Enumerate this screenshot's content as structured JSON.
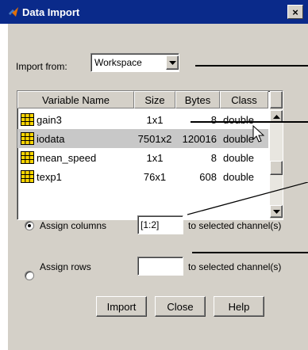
{
  "window": {
    "title": "Data Import",
    "close_glyph": "×"
  },
  "import_from": {
    "label": "Import from:",
    "value": "Workspace",
    "icon": "chevron-down-icon"
  },
  "table": {
    "columns": [
      "Variable Name",
      "Size",
      "Bytes",
      "Class"
    ],
    "rows": [
      {
        "name": "gain3",
        "size": "1x1",
        "bytes": "8",
        "class": "double",
        "selected": false
      },
      {
        "name": "iodata",
        "size": "7501x2",
        "bytes": "120016",
        "class": "double",
        "selected": true
      },
      {
        "name": "mean_speed",
        "size": "1x1",
        "bytes": "8",
        "class": "double",
        "selected": false
      },
      {
        "name": "texp1",
        "size": "76x1",
        "bytes": "608",
        "class": "double",
        "selected": false
      }
    ],
    "row_icon": "matrix-grid-icon"
  },
  "assign_columns": {
    "label": "Assign columns",
    "value": "[1:2]",
    "suffix": "to selected channel(s)",
    "checked": true
  },
  "assign_rows": {
    "label": "Assign rows",
    "value": "",
    "suffix": "to selected channel(s)",
    "checked": false
  },
  "buttons": {
    "import": "Import",
    "close": "Close",
    "help": "Help"
  },
  "colors": {
    "title_bar": "#0a2a8a",
    "dialog_bg": "#d4d0c8",
    "grid_icon": "#ffd700",
    "selected_row": "#c8c8c8"
  }
}
